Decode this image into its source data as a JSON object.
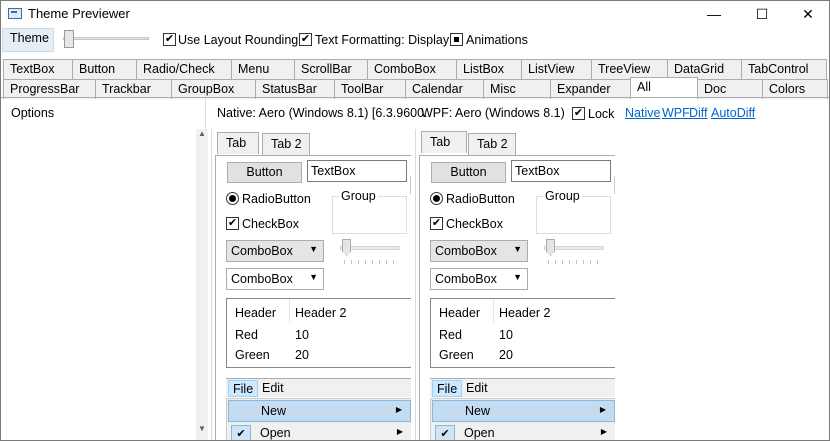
{
  "window": {
    "title": "Theme Previewer",
    "minimize": "—",
    "maximize": "☐",
    "close": "✕"
  },
  "toolbar": {
    "theme_label": "Theme",
    "layout_rounding": {
      "label": "Use Layout Rounding",
      "checked": true
    },
    "text_formatting": {
      "label": "Text Formatting: Display",
      "checked": true
    },
    "animations": {
      "label": "Animations",
      "state": "indeterminate"
    }
  },
  "tabs_row1": [
    "TextBox",
    "Button",
    "Radio/Check",
    "Menu",
    "ScrollBar",
    "ComboBox",
    "ListBox",
    "ListView",
    "TreeView",
    "DataGrid",
    "TabControl"
  ],
  "tabs_row2": [
    "ProgressBar",
    "Trackbar",
    "GroupBox",
    "StatusBar",
    "ToolBar",
    "Calendar",
    "Misc",
    "Expander",
    "All",
    "Doc",
    "Colors"
  ],
  "selected_tab": "All",
  "options_label": "Options",
  "native_header": "Native: Aero (Windows 8.1) [6.3.9600.",
  "wpf_header": "WPF: Aero (Windows 8.1)",
  "lock": {
    "label": "Lock",
    "checked": true
  },
  "links": [
    "Native",
    "WPF",
    "Diff",
    "AutoDiff"
  ],
  "panel": {
    "tab1": "Tab",
    "tab2": "Tab 2",
    "button": "Button",
    "textbox": "TextBox",
    "radio": "RadioButton",
    "checkbox": "CheckBox",
    "group": "Group",
    "combo1": "ComboBox",
    "combo2": "ComboBox",
    "listview": {
      "headers": [
        "Header",
        "Header 2"
      ],
      "rows": [
        [
          "Red",
          "10"
        ],
        [
          "Green",
          "20"
        ]
      ]
    },
    "menu": {
      "file": "File",
      "edit": "Edit",
      "items": [
        "New",
        "Open"
      ]
    }
  },
  "glyphs": {
    "check": "✔",
    "submenu": "▶",
    "dropdown": "▼",
    "scroll_up": "▲",
    "scroll_down": "▼"
  }
}
